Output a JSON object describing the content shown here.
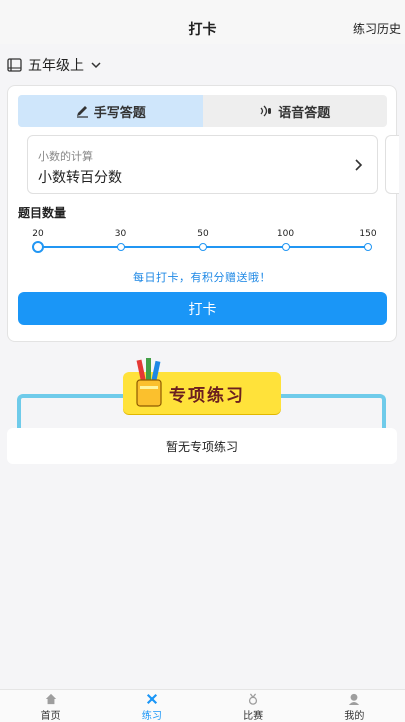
{
  "header": {
    "title": "打卡",
    "history": "练习历史"
  },
  "grade": {
    "label": "五年级上"
  },
  "tabs": [
    {
      "label": "手写答题",
      "icon": "pen-icon",
      "active": true
    },
    {
      "label": "语音答题",
      "icon": "voice-icon",
      "active": false
    }
  ],
  "topic": {
    "category": "小数的计算",
    "name": "小数转百分数"
  },
  "question_count": {
    "label": "题目数量",
    "options": [
      "20",
      "30",
      "50",
      "100",
      "150"
    ],
    "selected": "20"
  },
  "reward_text": "每日打卡，有积分赠送哦！",
  "checkin_button": "打卡",
  "special": {
    "banner": "专项练习",
    "empty": "暂无专项练习"
  },
  "nav": [
    {
      "label": "首页",
      "icon": "home-icon",
      "active": false
    },
    {
      "label": "练习",
      "icon": "practice-icon",
      "active": true
    },
    {
      "label": "比赛",
      "icon": "medal-icon",
      "active": false
    },
    {
      "label": "我的",
      "icon": "user-icon",
      "active": false
    }
  ],
  "colors": {
    "accent": "#1a96f7",
    "tab_active": "#cfe6fb",
    "banner": "#ffe23a",
    "frame": "#6fcbea"
  }
}
